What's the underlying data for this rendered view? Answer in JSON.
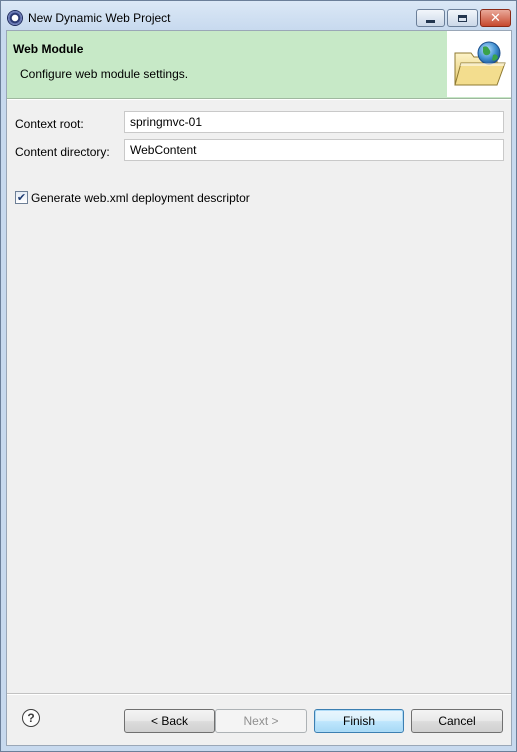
{
  "window": {
    "title": "New Dynamic Web Project",
    "controls": {
      "minimize": "minimize",
      "maximize": "maximize",
      "close": "✕"
    }
  },
  "banner": {
    "title": "Web Module",
    "description": "Configure web module settings.",
    "image_icon": "folder-globe-icon"
  },
  "form": {
    "context_root": {
      "label": "Context root:",
      "value": "springmvc-01"
    },
    "content_directory": {
      "label": "Content directory:",
      "value": "WebContent"
    },
    "generate_descriptor": {
      "label": "Generate web.xml deployment descriptor",
      "checked": true
    }
  },
  "footer": {
    "help_icon": "help-icon",
    "help_glyph": "?",
    "back_label": "< Back",
    "next_label": "Next >",
    "finish_label": "Finish",
    "cancel_label": "Cancel"
  },
  "colors": {
    "banner_background": "#c7e9c7",
    "dialog_background": "#f0f0f0",
    "close_button": "#c7492e"
  }
}
